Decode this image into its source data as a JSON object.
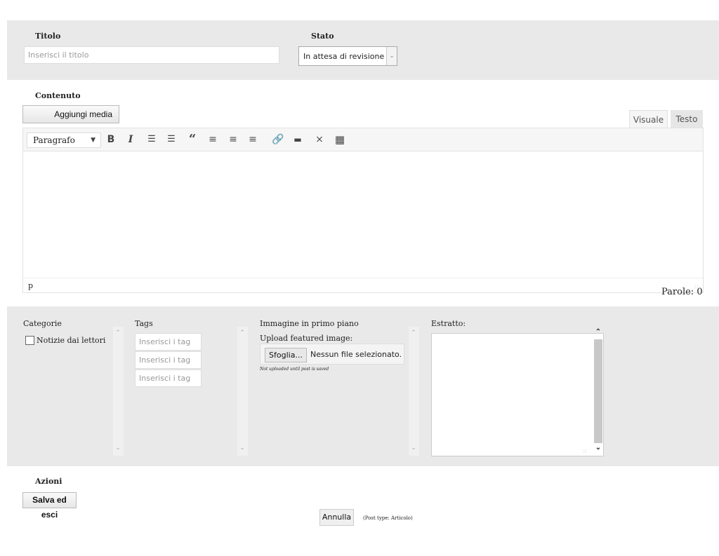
{
  "post": {
    "title_label": "Titolo",
    "title_placeholder": "Inserisci il titolo",
    "status_label": "Stato",
    "status_value": "In attesa di revisione"
  },
  "content": {
    "label": "Contenuto",
    "add_media": "Aggiungi media",
    "tabs": [
      "Visuale",
      "Testo"
    ],
    "format_select": "Paragrafo",
    "toolbar_icons": [
      "bold-icon",
      "italic-icon",
      "bullet-list-icon",
      "numbered-list-icon",
      "blockquote-icon",
      "align-left-icon",
      "align-center-icon",
      "align-right-icon",
      "link-icon",
      "read-more-icon",
      "fullscreen-icon",
      "toolbar-toggle-icon"
    ],
    "path": "p",
    "word_count": "Parole: 0"
  },
  "meta": {
    "categories_label": "Categorie",
    "categories": [
      "Notizie dai lettori"
    ],
    "tags_label": "Tags",
    "tag_placeholder": "Inserisci i tag",
    "featured_label": "Immagine in primo piano",
    "upload_label": "Upload featured image:",
    "browse_button": "Sfoglia...",
    "no_file": "Nessun file selezionato.",
    "upload_note": "Not uploaded until post is saved",
    "excerpt_label": "Estratto:"
  },
  "actions": {
    "label": "Azioni",
    "save_exit": "Salva ed esci",
    "cancel": "Annulla",
    "post_type": "(Post type: Articolo)"
  }
}
